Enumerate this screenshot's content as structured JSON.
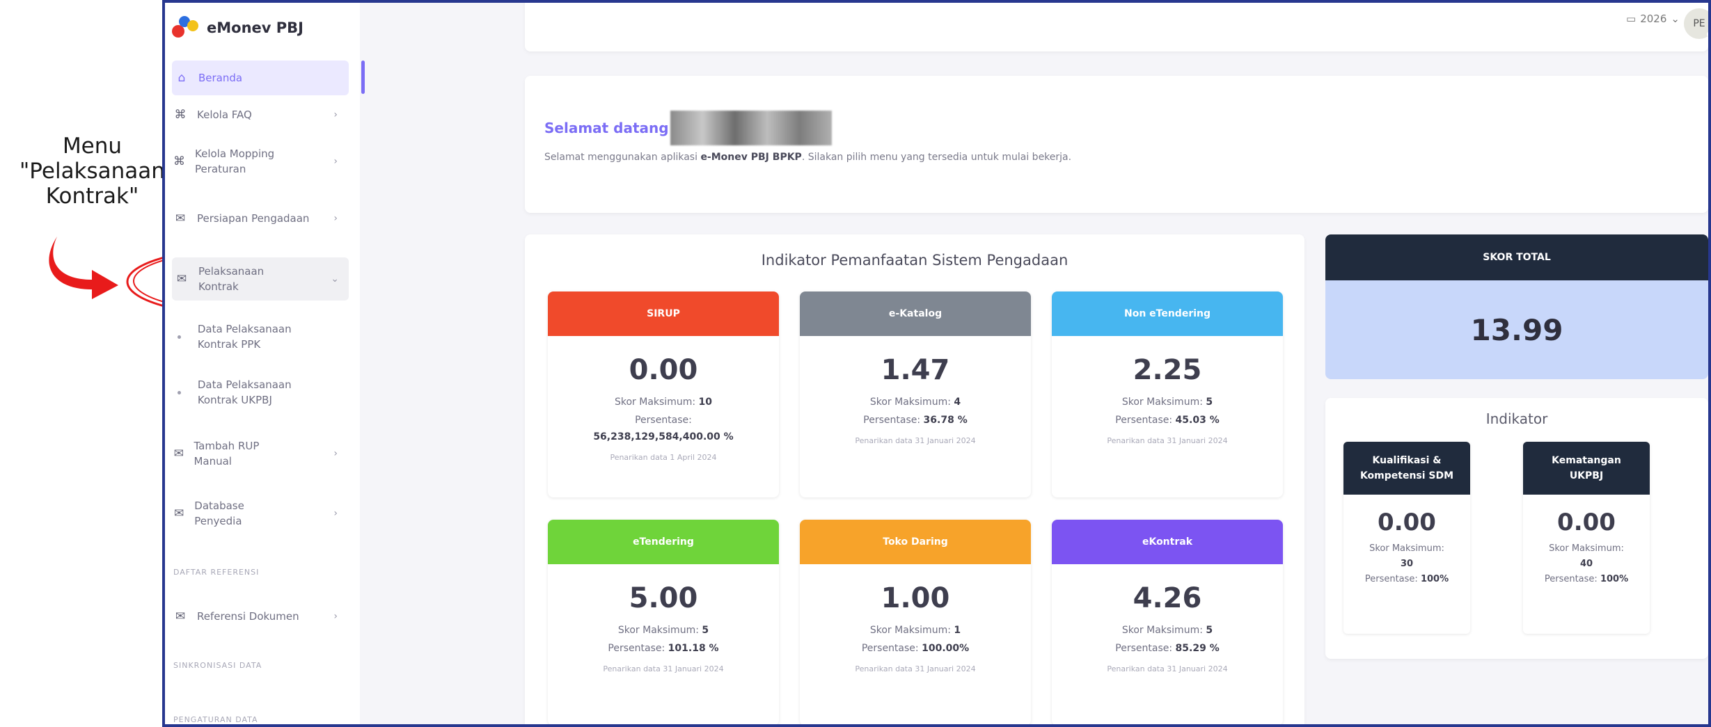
{
  "annotation": {
    "label": "Menu \"Pelaksanaan Kontrak\""
  },
  "brand": {
    "name": "eMonev PBJ"
  },
  "sidebar": {
    "items": [
      {
        "label": "Beranda",
        "icon": "home-icon"
      },
      {
        "label": "Kelola FAQ",
        "icon": "command-icon"
      },
      {
        "label": "Kelola Mopping Peraturan",
        "icon": "command-icon"
      },
      {
        "label": "Persiapan Pengadaan",
        "icon": "mail-icon"
      },
      {
        "label": "Pelaksanaan Kontrak",
        "icon": "mail-icon"
      },
      {
        "label": "Tambah RUP Manual",
        "icon": "mail-icon"
      },
      {
        "label": "Database Penyedia",
        "icon": "mail-icon"
      },
      {
        "label": "Referensi Dokumen",
        "icon": "mail-icon"
      }
    ],
    "subitems": [
      {
        "label": "Data Pelaksanaan Kontrak PPK"
      },
      {
        "label": "Data Pelaksanaan Kontrak UKPBJ"
      }
    ],
    "sections": {
      "daftar_referensi": "DAFTAR REFERENSI",
      "sinkronisasi": "SINKRONISASI DATA",
      "pengaturan": "PENGATURAN DATA"
    }
  },
  "topbar": {
    "year": "2026",
    "avatar_initials": "PE"
  },
  "welcome": {
    "greeting": "Selamat datang",
    "text_pre": "Selamat menggunakan aplikasi ",
    "text_bold": "e-Monev PBJ BPKP",
    "text_post": ". Silakan pilih menu yang tersedia untuk mulai bekerja."
  },
  "indicators": {
    "title": "Indikator Pemanfaatan Sistem Pengadaan",
    "tiles": [
      {
        "name": "SIRUP",
        "color": "#f04a2b",
        "value": "0.00",
        "max_label": "Skor Maksimum:",
        "max": "10",
        "pct_label": "Persentase:",
        "pct": "56,238,129,584,400.00 %",
        "note": "Penarikan data 1 April 2024"
      },
      {
        "name": "e-Katalog",
        "color": "#7f8792",
        "value": "1.47",
        "max_label": "Skor Maksimum:",
        "max": "4",
        "pct_label": "Persentase:",
        "pct": "36.78 %",
        "note": "Penarikan data 31 Januari 2024"
      },
      {
        "name": "Non eTendering",
        "color": "#47b6f0",
        "value": "2.25",
        "max_label": "Skor Maksimum:",
        "max": "5",
        "pct_label": "Persentase:",
        "pct": "45.03 %",
        "note": "Penarikan data 31 Januari 2024"
      },
      {
        "name": "eTendering",
        "color": "#6fd43a",
        "value": "5.00",
        "max_label": "Skor Maksimum:",
        "max": "5",
        "pct_label": "Persentase:",
        "pct": "101.18 %",
        "note": "Penarikan data 31 Januari 2024"
      },
      {
        "name": "Toko Daring",
        "color": "#f7a32a",
        "value": "1.00",
        "max_label": "Skor Maksimum:",
        "max": "1",
        "pct_label": "Persentase:",
        "pct": "100.00%",
        "note": "Penarikan data 31 Januari 2024"
      },
      {
        "name": "eKontrak",
        "color": "#7c54f2",
        "value": "4.26",
        "max_label": "Skor Maksimum:",
        "max": "5",
        "pct_label": "Persentase:",
        "pct": "85.29 %",
        "note": "Penarikan data 31 Januari 2024"
      }
    ]
  },
  "skor_total": {
    "label": "SKOR TOTAL",
    "value": "13.99"
  },
  "indikator": {
    "title": "Indikator",
    "tiles": [
      {
        "name_line1": "Kualifikasi &",
        "name_line2": "Kompetensi SDM",
        "value": "0.00",
        "max_label": "Skor Maksimum:",
        "max": "30",
        "pct_label": "Persentase:",
        "pct": "100%"
      },
      {
        "name_line1": "Kematangan",
        "name_line2": "UKPBJ",
        "value": "0.00",
        "max_label": "Skor Maksimum:",
        "max": "40",
        "pct_label": "Persentase:",
        "pct": "100%"
      }
    ]
  },
  "colors": {
    "accent": "#7b6df5",
    "dark_header": "#202b3d",
    "skor_bg": "#c8d7fa",
    "annotation_red": "#e81b1b",
    "frame_blue": "#27378f"
  }
}
